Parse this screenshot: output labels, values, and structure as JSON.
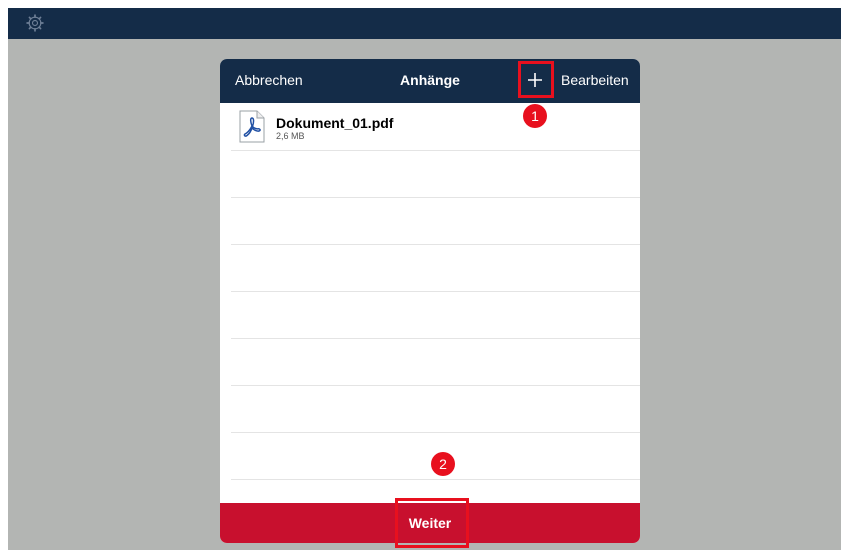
{
  "topbar": {
    "settings_icon": "gear-icon"
  },
  "modal": {
    "cancel_label": "Abbrechen",
    "title": "Anhänge",
    "add_icon": "plus-icon",
    "edit_label": "Bearbeiten",
    "files": [
      {
        "name": "Dokument_01.pdf",
        "size": "2,6 MB",
        "icon": "pdf-icon"
      }
    ],
    "continue_label": "Weiter"
  },
  "annotations": {
    "step1": "1",
    "step2": "2",
    "highlight_color": "#e8101e"
  },
  "colors": {
    "navy": "#142c48",
    "primary_red": "#c8102e",
    "backdrop": "#b3b5b3"
  }
}
